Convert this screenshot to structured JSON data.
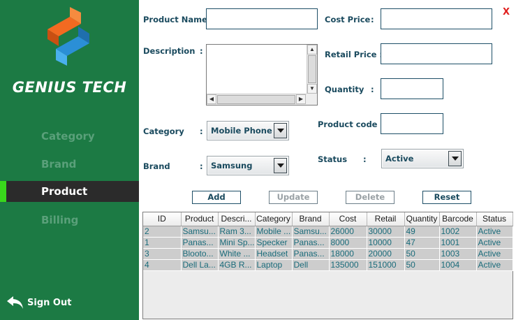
{
  "brand": {
    "name": "GENIUS TECH",
    "logo_icon": "genius-tech-logo-icon"
  },
  "sidebar": {
    "items": [
      {
        "label": "Category"
      },
      {
        "label": "Brand"
      },
      {
        "label": "Product"
      },
      {
        "label": "Billing"
      }
    ],
    "active": "Product",
    "signout_label": "Sign Out",
    "signout_icon": "back-arrow-icon"
  },
  "form": {
    "close_label": "X",
    "product_name_label": "Product Name :",
    "product_name_value": "",
    "description_label": "Description",
    "description_colon": ":",
    "description_value": "",
    "category_label": "Category",
    "category_colon": ":",
    "category_value": "Mobile Phone",
    "brand_label": "Brand",
    "brand_colon": ":",
    "brand_value": "Samsung",
    "cost_price_label": "Cost Price",
    "cost_price_colon": ":",
    "cost_price_value": "",
    "retail_price_label": "Retail Price :",
    "retail_price_value": "",
    "quantity_label": "Quantity",
    "quantity_colon": ":",
    "quantity_value": "",
    "product_code_label": "Product code :",
    "product_code_value": "",
    "status_label": "Status",
    "status_colon": ":",
    "status_value": "Active"
  },
  "buttons": {
    "add": "Add",
    "update": "Update",
    "delete": "Delete",
    "reset": "Reset"
  },
  "table": {
    "columns": [
      "ID",
      "Product",
      "Descri...",
      "Category",
      "Brand",
      "Cost",
      "Retail",
      "Quantity",
      "Barcode",
      "Status"
    ],
    "rows": [
      [
        "2",
        "Samsu...",
        "Ram 3...",
        "Mobile ...",
        "Samsu...",
        "26000",
        "30000",
        "49",
        "1002",
        "Active"
      ],
      [
        "1",
        "Panas...",
        "Mini Sp...",
        "Specker",
        "Panas...",
        "8000",
        "10000",
        "47",
        "1001",
        "Active"
      ],
      [
        "3",
        "Blooto...",
        "White ...",
        "Headset",
        "Panas...",
        "18000",
        "20000",
        "50",
        "1003",
        "Active"
      ],
      [
        "4",
        "Dell La...",
        "4GB R...",
        "Laptop",
        "Dell",
        "135000",
        "151000",
        "50",
        "1004",
        "Active"
      ]
    ]
  },
  "colors": {
    "sidebar_bg": "#1c7a44",
    "active_bg": "#2b2b2b",
    "active_marker": "#39d81c",
    "label_text": "#1a4a5e",
    "close_red": "#e0201f"
  }
}
